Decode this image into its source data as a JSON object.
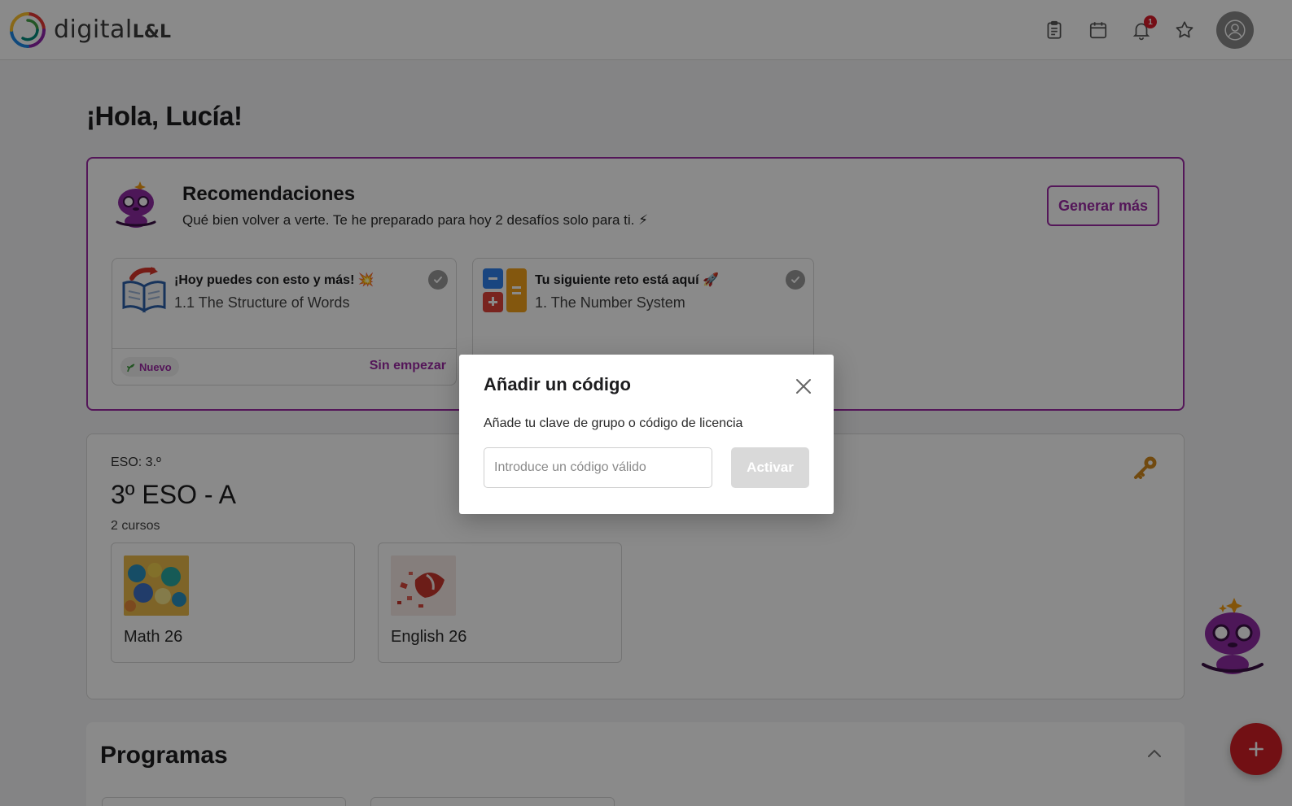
{
  "app": {
    "brand_text": "digital",
    "brand_suffix": "L&L"
  },
  "header": {
    "icons": [
      "clipboard-icon",
      "calendar-icon",
      "bell-icon",
      "star-icon",
      "user-icon"
    ],
    "notification_count": "1"
  },
  "greeting": "¡Hola, Lucía!",
  "recommendations": {
    "title": "Recomendaciones",
    "subtitle": "Qué bien volver a verte. Te he preparado para hoy 2 desafíos solo para ti. ⚡",
    "generate_button": "Generar más",
    "cards": [
      {
        "title": "¡Hoy puedes con esto y más! 💥",
        "lesson": "1.1 The Structure of Words",
        "tag": "Nuevo",
        "status": "Sin empezar"
      },
      {
        "title": "Tu siguiente reto está aquí 🚀",
        "lesson": "1. The Number System"
      }
    ]
  },
  "group": {
    "level": "ESO: 3.º",
    "name": "3º ESO - A",
    "course_count": "2 cursos",
    "courses": [
      {
        "name": "Math 26"
      },
      {
        "name": "English 26"
      }
    ]
  },
  "programs": {
    "title": "Programas"
  },
  "modal": {
    "title": "Añadir un código",
    "description": "Añade tu clave de grupo o código de licencia",
    "input_placeholder": "Introduce un código válido",
    "input_value": "",
    "activate_button": "Activar"
  },
  "colors": {
    "accent": "#9c2aa4",
    "fab": "#d31f26",
    "badge": "#d81b2a"
  }
}
